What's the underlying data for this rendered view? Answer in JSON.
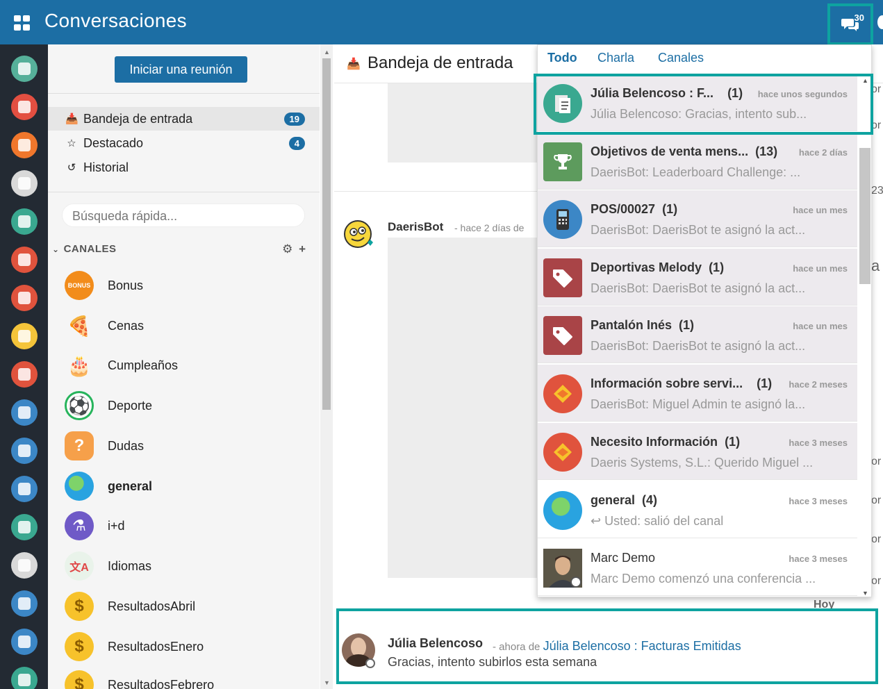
{
  "app": {
    "title": "Conversaciones",
    "message_count": "30"
  },
  "sidebar": {
    "start_meeting": "Iniciar una reunión",
    "nav": [
      {
        "label": "Bandeja de entrada",
        "count": "19"
      },
      {
        "label": "Destacado",
        "count": "4"
      },
      {
        "label": "Historial",
        "count": ""
      }
    ],
    "search_placeholder": "Búsqueda rápida...",
    "channels_header": "CANALES",
    "channels": [
      {
        "label": "Bonus",
        "icon": "bonus-icon"
      },
      {
        "label": "Cenas",
        "icon": "pizza-icon"
      },
      {
        "label": "Cumpleaños",
        "icon": "cake-icon"
      },
      {
        "label": "Deporte",
        "icon": "soccer-ball-icon"
      },
      {
        "label": "Dudas",
        "icon": "question-icon"
      },
      {
        "label": "general",
        "icon": "globe-icon"
      },
      {
        "label": "i+d",
        "icon": "flask-icon"
      },
      {
        "label": "Idiomas",
        "icon": "translate-icon"
      },
      {
        "label": "ResultadosAbril",
        "icon": "dollar-icon"
      },
      {
        "label": "ResultadosEnero",
        "icon": "dollar-icon"
      },
      {
        "label": "ResultadosFebrero",
        "icon": "dollar-icon"
      }
    ]
  },
  "main": {
    "title": "Bandeja de entrada",
    "bot_name": "DaerisBot",
    "bot_meta": "- hace 2 días  de",
    "day_separator": "Hoy",
    "last_message": {
      "author": "Júlia Belencoso",
      "when": "- ahora",
      "from_word": "de",
      "thread": "Júlia Belencoso : Facturas Emitidas",
      "body": "Gracias, intento subirlos esta semana"
    },
    "right_edge_fragments": [
      "or",
      "or",
      "23",
      "a",
      "or",
      "or",
      "or",
      "or"
    ]
  },
  "dropdown": {
    "tabs": [
      "Todo",
      "Charla",
      "Canales"
    ],
    "items": [
      {
        "title": "Júlia Belencoso : F...",
        "count": "(1)",
        "when": "hace unos segundos",
        "preview": "Júlia Belencoso: Gracias, intento sub...",
        "icon": "document-icon",
        "unread": true
      },
      {
        "title": "Objetivos de venta mens...",
        "count": "(13)",
        "when": "hace 2 días",
        "preview": "DaerisBot: Leaderboard Challenge: ...",
        "icon": "trophy-icon",
        "unread": true
      },
      {
        "title": "POS/00027",
        "count": "(1)",
        "when": "hace un mes",
        "preview": "DaerisBot: DaerisBot te asignó la act...",
        "icon": "pos-terminal-icon",
        "unread": true
      },
      {
        "title": "Deportivas Melody",
        "count": "(1)",
        "when": "hace un mes",
        "preview": "DaerisBot: DaerisBot te asignó la act...",
        "icon": "tag-icon",
        "unread": true
      },
      {
        "title": "Pantalón Inés",
        "count": "(1)",
        "when": "hace un mes",
        "preview": "DaerisBot: DaerisBot te asignó la act...",
        "icon": "tag-icon",
        "unread": true
      },
      {
        "title": "Información sobre servi...",
        "count": "(1)",
        "when": "hace 2 meses",
        "preview": "DaerisBot: Miguel Admin te asignó la...",
        "icon": "handshake-icon",
        "unread": true
      },
      {
        "title": "Necesito Información",
        "count": "(1)",
        "when": "hace 3 meses",
        "preview": "Daeris Systems, S.L.: Querido Miguel ...",
        "icon": "handshake-icon",
        "unread": true
      },
      {
        "title": "general",
        "count": "(4)",
        "when": "hace 3 meses",
        "preview": "Usted: salió del canal",
        "icon": "globe-icon",
        "unread": false
      },
      {
        "title": "Marc Demo",
        "count": "",
        "when": "hace 3 meses",
        "preview": "Marc Demo comenzó una conferencia ...",
        "icon": "user-avatar-icon",
        "unread": false
      }
    ]
  },
  "colors": {
    "brand": "#1c6ea4",
    "highlight": "#0ea3a0",
    "unread_bg": "#edeaee"
  }
}
